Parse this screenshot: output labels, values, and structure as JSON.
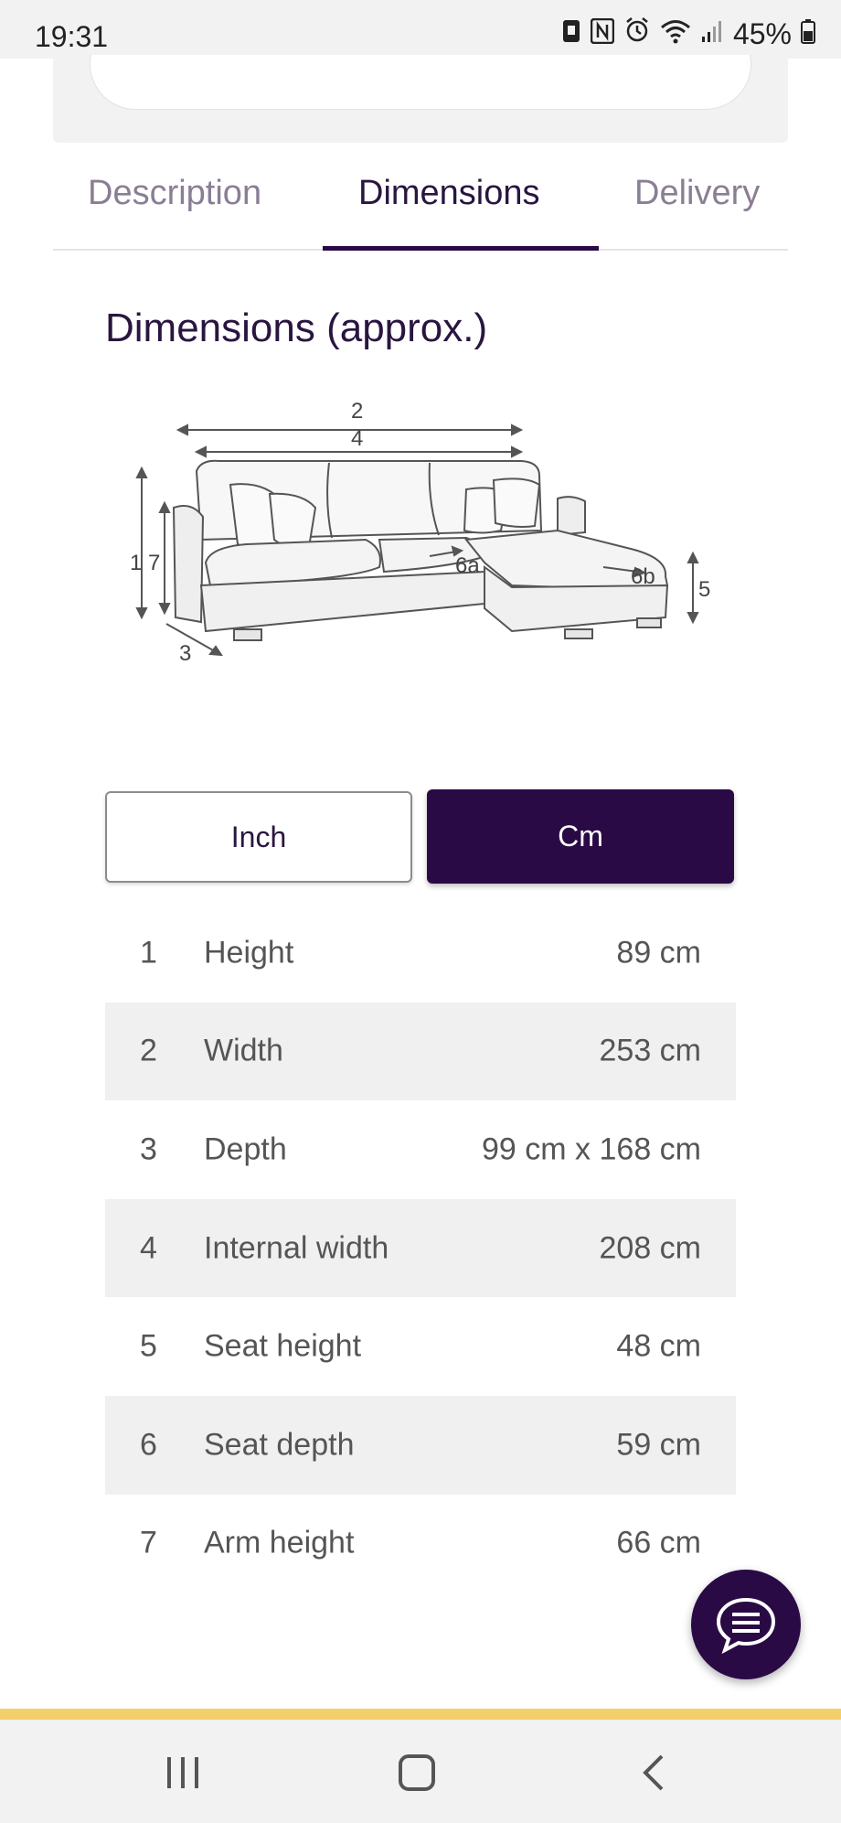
{
  "status": {
    "time": "19:31",
    "battery": "45%"
  },
  "tabs": [
    {
      "label": "Description"
    },
    {
      "label": "Dimensions"
    },
    {
      "label": "Delivery"
    }
  ],
  "section": {
    "title": "Dimensions (approx.)"
  },
  "diagram_labels": {
    "l1": "1",
    "l2": "2",
    "l3": "3",
    "l4": "4",
    "l5": "5",
    "l6a": "6a",
    "l6b": "6b",
    "l7": "7"
  },
  "units": {
    "inch_label": "Inch",
    "cm_label": "Cm",
    "selected": "Cm"
  },
  "dimensions": [
    {
      "num": "1",
      "label": "Height",
      "value": "89 cm"
    },
    {
      "num": "2",
      "label": "Width",
      "value": "253 cm"
    },
    {
      "num": "3",
      "label": "Depth",
      "value": "99 cm x 168 cm"
    },
    {
      "num": "4",
      "label": "Internal width",
      "value": "208 cm"
    },
    {
      "num": "5",
      "label": "Seat height",
      "value": "48 cm"
    },
    {
      "num": "6",
      "label": "Seat depth",
      "value": "59 cm"
    },
    {
      "num": "7",
      "label": "Arm height",
      "value": "66 cm"
    }
  ],
  "colors": {
    "brand": "#2a0a45",
    "accent_bar": "#f2cf6a"
  }
}
